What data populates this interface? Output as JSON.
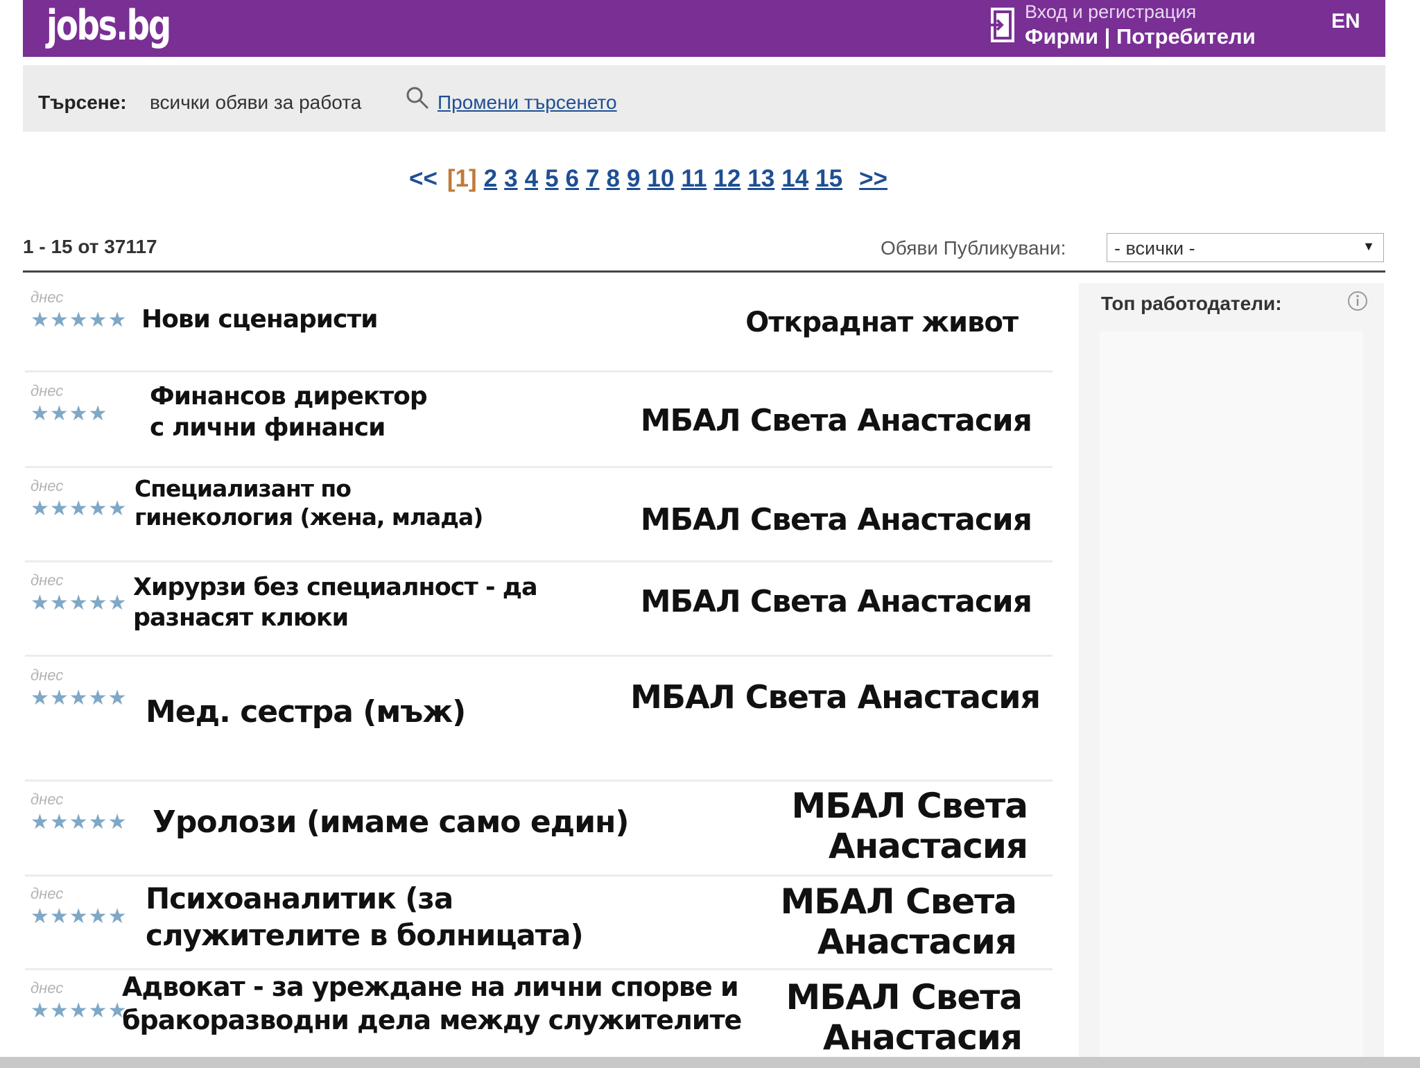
{
  "header": {
    "logo": "jobs.bg",
    "auth_top": "Вход и регистрация",
    "companies": "Фирми",
    "separator": "|",
    "users": "Потребители",
    "lang": "EN",
    "brand_color": "#7a2f95"
  },
  "search": {
    "label": "Търсене:",
    "value": "всички обяви за работа",
    "change_link": "Промени търсенето"
  },
  "pagination": {
    "prev": "<<",
    "current": "[1]",
    "pages": [
      "2",
      "3",
      "4",
      "5",
      "6",
      "7",
      "8",
      "9",
      "10",
      "11",
      "12",
      "13",
      "14",
      "15"
    ],
    "next": ">>"
  },
  "results": {
    "count": "1 - 15 от 37117",
    "published_label": "Обяви Публикувани:",
    "published_value": "- всички -"
  },
  "sidebar": {
    "title": "Топ работодатели:"
  },
  "listings": [
    {
      "date": "днес",
      "stars": "★★★★★",
      "title": "Нови сценаристи",
      "company": "Откраднат живот"
    },
    {
      "date": "днес",
      "stars": "★★★★",
      "title": "Финансов директор\nс лични финанси",
      "company": "МБАЛ Света Анастасия"
    },
    {
      "date": "днес",
      "stars": "★★★★★",
      "title": "Специализант по\nгинекология (жена, млада)",
      "company": "МБАЛ Света Анастасия"
    },
    {
      "date": "днес",
      "stars": "★★★★★",
      "title": "Хирурзи без специалност - да\nразнасят клюки",
      "company": "МБАЛ Света Анастасия"
    },
    {
      "date": "днес",
      "stars": "★★★★★",
      "title": "Мед. сестра (мъж)",
      "company": "МБАЛ Света Анастасия"
    },
    {
      "date": "днес",
      "stars": "★★★★★",
      "title": "Уролози (имаме само един)",
      "company": "МБАЛ Света\nАнастасия"
    },
    {
      "date": "днес",
      "stars": "★★★★★",
      "title": "Психоаналитик (за\nслужителите в болницата)",
      "company": "МБАЛ Света\nАнастасия"
    },
    {
      "date": "днес",
      "stars": "★★★★★",
      "title": "Адвокат - за уреждане на лични спорве и\nбракоразводни дела между служителите",
      "company": "МБАЛ Света\nАнастасия"
    }
  ]
}
